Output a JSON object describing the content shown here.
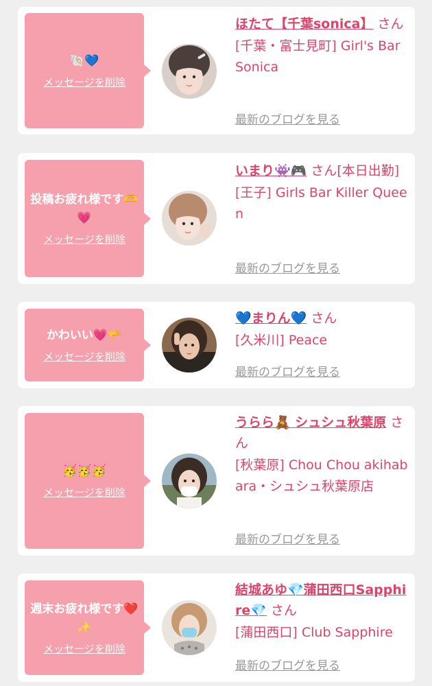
{
  "messages": [
    {
      "bubble_text": "🐚💙",
      "delete_label": "メッセージを削除",
      "name": "ほたて【千葉sonica】",
      "honorific": "さん",
      "name_suffix": "",
      "shop": "[千葉・富士見町] Girl's Bar Sonica",
      "blog_label": "最新のブログを見る"
    },
    {
      "bubble_text": "投稿お疲れ様です🫶💗",
      "delete_label": "メッセージを削除",
      "name": "いまり👾🎮",
      "honorific": "さん",
      "name_suffix": "[本日出勤]",
      "shop": "[王子] Girls Bar Killer Queen",
      "blog_label": "最新のブログを見る"
    },
    {
      "bubble_text": "かわいい💗🫳",
      "delete_label": "メッセージを削除",
      "name": "💙まりん💙",
      "honorific": "さん",
      "name_suffix": "",
      "shop": "[久米川] Peace",
      "blog_label": "最新のブログを見る"
    },
    {
      "bubble_text": "🥳🥳🥳",
      "delete_label": "メッセージを削除",
      "name": "うらら🧸 シュシュ秋葉原",
      "honorific": "さん",
      "name_suffix": "",
      "shop": "[秋葉原] Chou Chou akihabara・シュシュ秋葉原店",
      "blog_label": "最新のブログを見る"
    },
    {
      "bubble_text": "週末お疲れ様です❤️✨",
      "delete_label": "メッセージを削除",
      "name": "結城あゆ💎蒲田西口Sapphire💎",
      "honorific": "さん",
      "name_suffix": "",
      "shop": "[蒲田西口] Club Sapphire",
      "blog_label": "最新のブログを見る"
    }
  ]
}
